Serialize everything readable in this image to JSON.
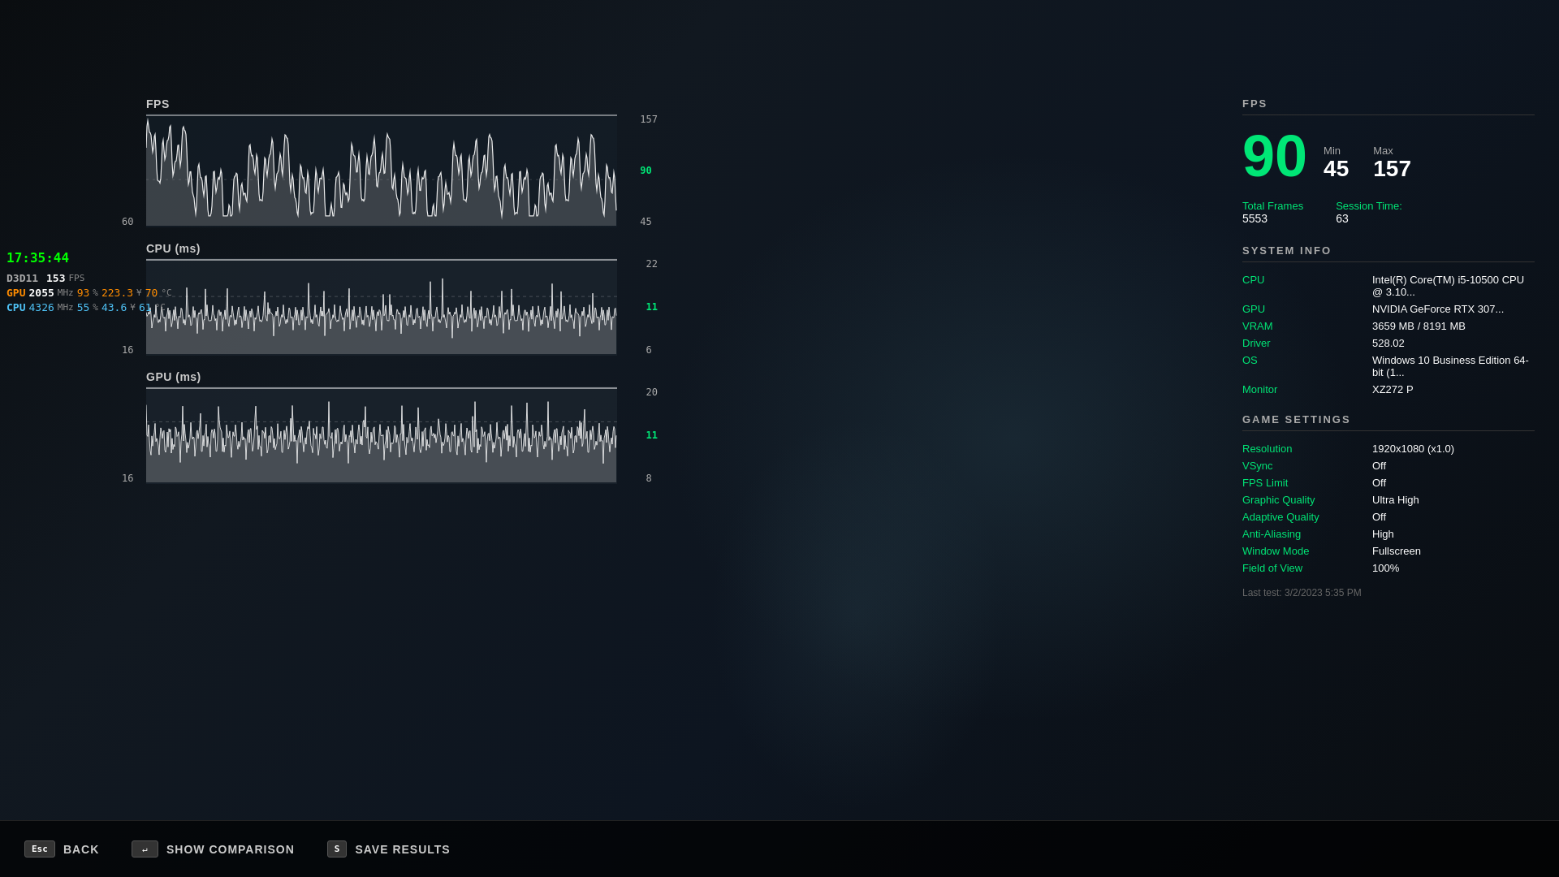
{
  "background": {
    "color": "#0a0e10"
  },
  "time": "17:35:44",
  "overlay_stats": {
    "d3d11": {
      "label": "D3D11",
      "value": "153",
      "unit": "FPS"
    },
    "gpu": {
      "label": "GPU",
      "freq": "2055",
      "freq_unit": "MHz",
      "load": "93",
      "load_unit": "%",
      "clock": "223.3",
      "clock_unit": "¥",
      "temp": "70",
      "temp_unit": "°C"
    },
    "cpu": {
      "label": "CPU",
      "freq": "4326",
      "freq_unit": "MHz",
      "load": "55",
      "load_unit": "%",
      "clock": "43.6",
      "clock_unit": "¥",
      "temp": "61",
      "temp_unit": "°C"
    }
  },
  "charts": {
    "fps": {
      "title": "FPS",
      "max_label": "157",
      "mid_label": "90",
      "min_label": "60",
      "bottom_label": "45",
      "current_val": "90",
      "color": "#ffffff"
    },
    "cpu_ms": {
      "title": "CPU (ms)",
      "max_label": "22",
      "mid_label": "11",
      "left_label": "16",
      "bottom_label": "6",
      "current_val": "11",
      "color": "#ffffff"
    },
    "gpu_ms": {
      "title": "GPU (ms)",
      "max_label": "20",
      "mid_label": "11",
      "left_label": "16",
      "bottom_label": "8",
      "current_val": "11",
      "color": "#ffffff"
    }
  },
  "fps_panel": {
    "section_title": "FPS",
    "current": "90",
    "min_label": "Min",
    "min_val": "45",
    "max_label": "Max",
    "max_val": "157",
    "total_frames_label": "Total Frames",
    "total_frames_val": "5553",
    "session_time_label": "Session Time:",
    "session_time_val": "63"
  },
  "system_info": {
    "section_title": "SYSTEM INFO",
    "cpu_label": "CPU",
    "cpu_val": "Intel(R) Core(TM) i5-10500 CPU @ 3.10...",
    "gpu_label": "GPU",
    "gpu_val": "NVIDIA GeForce RTX 307...",
    "vram_label": "VRAM",
    "vram_val": "3659 MB / 8191 MB",
    "driver_label": "Driver",
    "driver_val": "528.02",
    "os_label": "OS",
    "os_val": "Windows 10 Business Edition 64-bit (1...",
    "monitor_label": "Monitor",
    "monitor_val": "XZ272 P"
  },
  "game_settings": {
    "section_title": "GAME SETTINGS",
    "resolution_label": "Resolution",
    "resolution_val": "1920x1080 (x1.0)",
    "vsync_label": "VSync",
    "vsync_val": "Off",
    "fps_limit_label": "FPS Limit",
    "fps_limit_val": "Off",
    "graphic_quality_label": "Graphic Quality",
    "graphic_quality_val": "Ultra High",
    "adaptive_quality_label": "Adaptive Quality",
    "adaptive_quality_val": "Off",
    "anti_aliasing_label": "Anti-Aliasing",
    "anti_aliasing_val": "High",
    "window_mode_label": "Window Mode",
    "window_mode_val": "Fullscreen",
    "field_of_view_label": "Field of View",
    "field_of_view_val": "100%",
    "last_test": "Last test: 3/2/2023 5:35 PM"
  },
  "bottom_bar": {
    "back_key": "Esc",
    "back_label": "BACK",
    "comparison_key": "↵",
    "comparison_label": "SHOW COMPARISON",
    "save_key": "S",
    "save_label": "SAVE RESULTS"
  }
}
